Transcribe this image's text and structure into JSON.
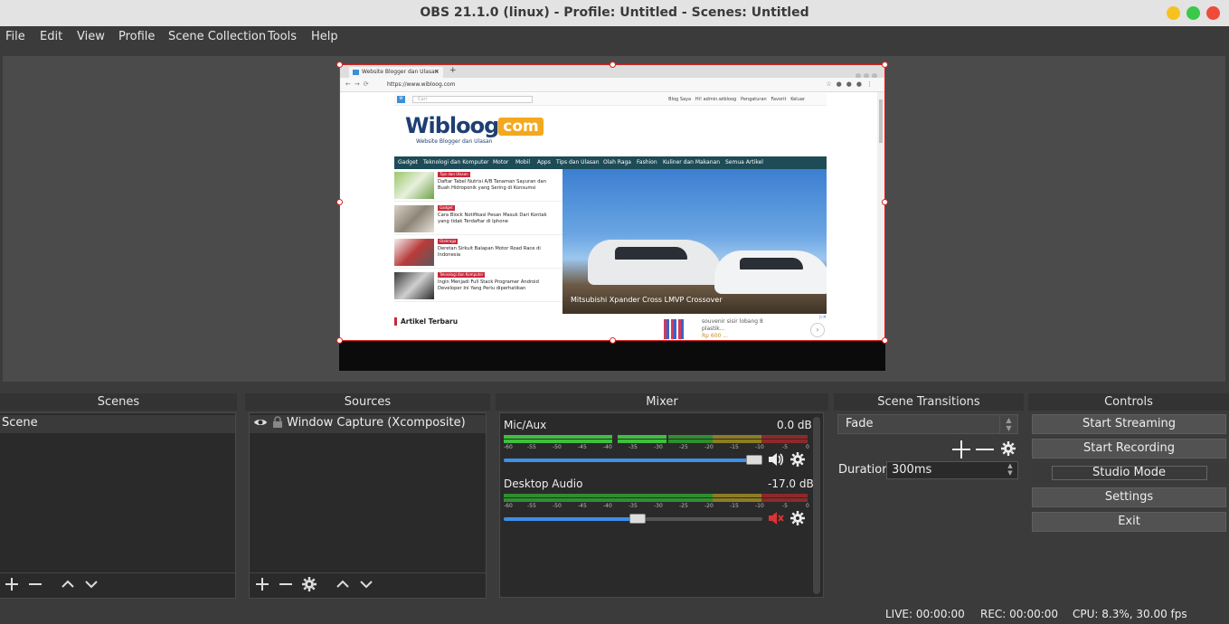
{
  "window": {
    "title": "OBS 21.1.0 (linux) - Profile: Untitled - Scenes: Untitled",
    "colors": {
      "minimize": "#f7c21f",
      "maximize": "#3ac94a",
      "close": "#f04a3a"
    }
  },
  "menubar": {
    "items": [
      "File",
      "Edit",
      "View",
      "Profile",
      "Scene Collection",
      "Tools",
      "Help"
    ]
  },
  "preview": {
    "browser": {
      "tab_title": "Website Blogger dan Ulasan",
      "url": "https://www.wibloog.com"
    },
    "website": {
      "search_placeholder": "Cari",
      "top_links": [
        "Blog Saya",
        "Hi! admin.wibloog",
        "Pengaturan",
        "Favorit",
        "Keluar"
      ],
      "logo_main": "Wibloog",
      "logo_com": "com",
      "tagline": "Website Blogger dan Ulasan",
      "nav": [
        "Gadget",
        "Teknologi dan Komputer",
        "Motor",
        "Mobil",
        "Apps",
        "Tips dan Ulasan",
        "Olah Raga",
        "Fashion",
        "Kuliner dan Makanan",
        "Semua Artikel"
      ],
      "articles": [
        {
          "category": "Tips dan Ulasan",
          "title": "Daftar Tabel Nutrisi A/B Tanaman Sayuran dan Buah Hidroponik yang Sering di Konsumsi"
        },
        {
          "category": "Gadget",
          "title": "Cara Block Notifikasi Pesan Masuk Dari Kontak yang tidak Terdaftar di Iphone"
        },
        {
          "category": "Olahraga",
          "title": "Deretan Sirkuit Balapan Motor Road Race di Indonesia"
        },
        {
          "category": "Teknologi dan Komputer",
          "title": "Ingin Menjadi Full Stack Programer Android Developer Ini Yang Perlu diperhatikan"
        }
      ],
      "hero_caption": "Mitsubishi Xpander Cross LMVP Crossover",
      "latest_heading": "Artikel Terbaru",
      "ad_text": "souvenir sisir lobang 8 plastik...",
      "ad_price": "Rp 600 ..."
    }
  },
  "scenes": {
    "title": "Scenes",
    "items": [
      "Scene"
    ]
  },
  "sources": {
    "title": "Sources",
    "items": [
      "Window Capture (Xcomposite)"
    ]
  },
  "mixer": {
    "title": "Mixer",
    "ticks": [
      "-60",
      "-55",
      "-50",
      "-45",
      "-40",
      "-35",
      "-30",
      "-25",
      "-20",
      "-15",
      "-10",
      "-5",
      "0"
    ],
    "channels": [
      {
        "name": "Mic/Aux",
        "db": "0.0 dB",
        "volume": 1.0,
        "muted": false
      },
      {
        "name": "Desktop Audio",
        "db": "-17.0 dB",
        "volume": 0.52,
        "muted": true
      }
    ],
    "colors": {
      "green": "#3fbf3f",
      "yellow": "#c8b12a",
      "red": "#c83a3a",
      "slider": "#3d8fe8"
    }
  },
  "transitions": {
    "title": "Scene Transitions",
    "selected": "Fade",
    "duration_label": "Duration",
    "duration_value": "300ms"
  },
  "controls": {
    "title": "Controls",
    "start_streaming": "Start Streaming",
    "start_recording": "Start Recording",
    "studio_mode": "Studio Mode",
    "settings": "Settings",
    "exit": "Exit"
  },
  "status": {
    "live": "LIVE: 00:00:00",
    "rec": "REC: 00:00:00",
    "cpu": "CPU: 8.3%, 30.00 fps"
  }
}
